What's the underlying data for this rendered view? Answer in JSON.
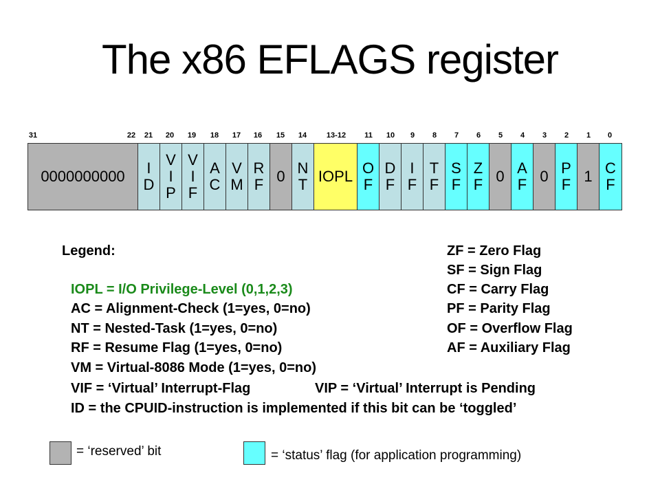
{
  "title": "The x86 EFLAGS register",
  "bit_numbers": [
    "31",
    "22",
    "21",
    "20",
    "19",
    "18",
    "17",
    "16",
    "15",
    "14",
    "13-12",
    "11",
    "10",
    "9",
    "8",
    "7",
    "6",
    "5",
    "4",
    "3",
    "2",
    "1",
    "0"
  ],
  "cells": [
    {
      "bits": "31-22",
      "lines": [
        "0000000000"
      ],
      "kind": "reserved"
    },
    {
      "bits": "21",
      "lines": [
        "I",
        "D"
      ],
      "kind": "system"
    },
    {
      "bits": "20",
      "lines": [
        "V",
        "I",
        "P"
      ],
      "kind": "system"
    },
    {
      "bits": "19",
      "lines": [
        "V",
        "I",
        "F"
      ],
      "kind": "system"
    },
    {
      "bits": "18",
      "lines": [
        "A",
        "C"
      ],
      "kind": "system"
    },
    {
      "bits": "17",
      "lines": [
        "V",
        "M"
      ],
      "kind": "system"
    },
    {
      "bits": "16",
      "lines": [
        "R",
        "F"
      ],
      "kind": "system"
    },
    {
      "bits": "15",
      "lines": [
        "0"
      ],
      "kind": "reserved"
    },
    {
      "bits": "14",
      "lines": [
        "N",
        "T"
      ],
      "kind": "system"
    },
    {
      "bits": "13-12",
      "lines": [
        "IOPL"
      ],
      "kind": "iopl"
    },
    {
      "bits": "11",
      "lines": [
        "O",
        "F"
      ],
      "kind": "status"
    },
    {
      "bits": "10",
      "lines": [
        "D",
        "F"
      ],
      "kind": "system"
    },
    {
      "bits": "9",
      "lines": [
        "I",
        "F"
      ],
      "kind": "system"
    },
    {
      "bits": "8",
      "lines": [
        "T",
        "F"
      ],
      "kind": "system"
    },
    {
      "bits": "7",
      "lines": [
        "S",
        "F"
      ],
      "kind": "status"
    },
    {
      "bits": "6",
      "lines": [
        "Z",
        "F"
      ],
      "kind": "status"
    },
    {
      "bits": "5",
      "lines": [
        "0"
      ],
      "kind": "reserved"
    },
    {
      "bits": "4",
      "lines": [
        "A",
        "F"
      ],
      "kind": "status"
    },
    {
      "bits": "3",
      "lines": [
        "0"
      ],
      "kind": "reserved"
    },
    {
      "bits": "2",
      "lines": [
        "P",
        "F"
      ],
      "kind": "status"
    },
    {
      "bits": "1",
      "lines": [
        "1"
      ],
      "kind": "reserved"
    },
    {
      "bits": "0",
      "lines": [
        "C",
        "F"
      ],
      "kind": "status"
    }
  ],
  "colors": {
    "reserved": "#b3b3b3",
    "system": "#bde0e4",
    "status": "#66ffff",
    "iopl": "#ffff66",
    "iopl_text": "#1a8a1a"
  },
  "legend": {
    "title": "Legend:",
    "left": [
      "IOPL = I/O Privilege-Level (0,1,2,3)",
      "AC = Alignment-Check (1=yes, 0=no)",
      "NT = Nested-Task (1=yes, 0=no)",
      "RF = Resume Flag (1=yes, 0=no)",
      "VM = Virtual-8086 Mode (1=yes, 0=no)",
      "VIF = ‘Virtual’ Interrupt-Flag",
      "ID = the CPUID-instruction is implemented if this bit can be ‘toggled’"
    ],
    "vip": "VIP = ‘Virtual’ Interrupt is Pending",
    "right": [
      "ZF = Zero Flag",
      "SF = Sign Flag",
      "CF = Carry Flag",
      "PF = Parity Flag",
      "OF = Overflow Flag",
      "AF = Auxiliary Flag"
    ]
  },
  "key": {
    "reserved_label": "= ‘reserved’ bit",
    "status_label": "= ‘status’ flag (for application programming)"
  }
}
